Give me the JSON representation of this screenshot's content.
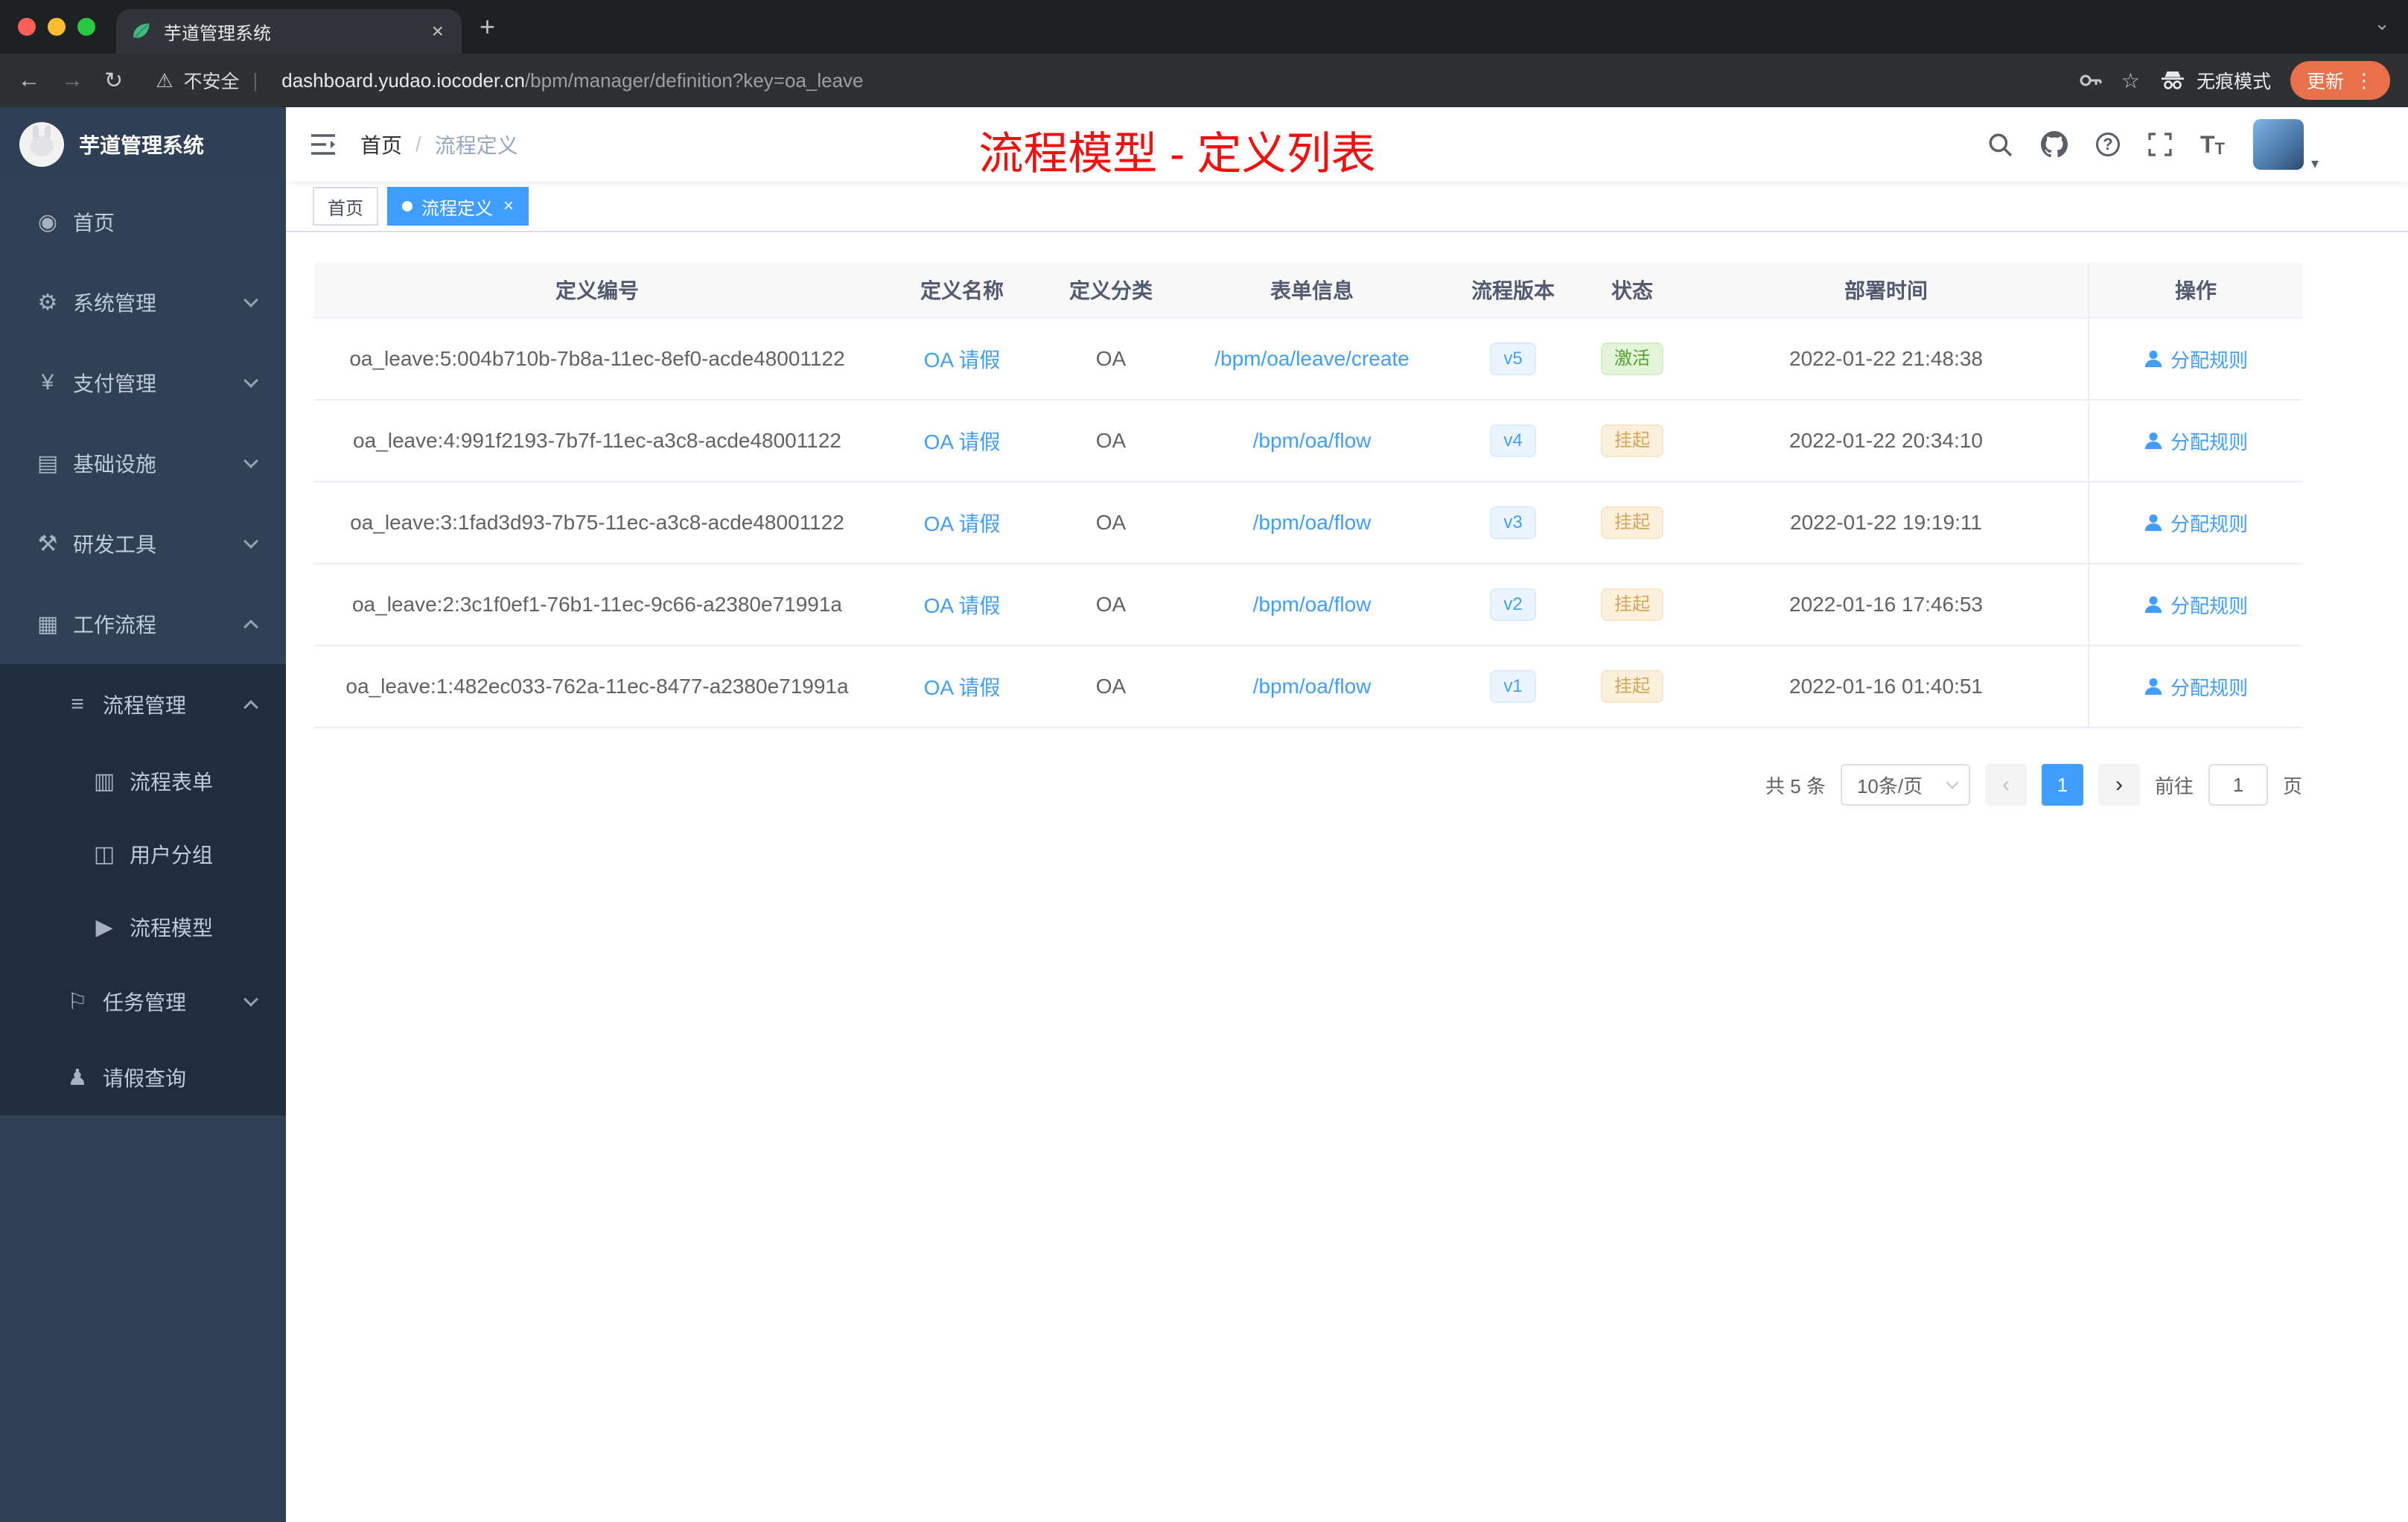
{
  "colors": {
    "accent": "#409eff",
    "sidebar": "#304156",
    "sidebar_sub": "#1f2d3d",
    "annotation_red": "#f40f0f"
  },
  "browser": {
    "tab": {
      "title": "芋道管理系统",
      "close": "×",
      "new_tab": "+"
    },
    "toolbar": {
      "security_label": "不安全",
      "url_host": "dashboard.yudao.iocoder.cn",
      "url_path": "/bpm/manager/definition?key=oa_leave",
      "incognito_label": "无痕模式",
      "update_label": "更新"
    }
  },
  "icons": {
    "back": "←",
    "forward": "→",
    "reload": "↻",
    "warning": "⚠",
    "divider": "|",
    "star": "☆",
    "kebab": "⋮",
    "tab_overflow": "⌄",
    "help": "?",
    "caret": "▾",
    "t_large": "T",
    "t_small": "T"
  },
  "sidebar": {
    "logo_title": "芋道管理系统",
    "menu": [
      {
        "label": "首页",
        "icon": "◉"
      },
      {
        "label": "系统管理",
        "icon": "⚙"
      },
      {
        "label": "支付管理",
        "icon": "¥"
      },
      {
        "label": "基础设施",
        "icon": "▤"
      },
      {
        "label": "研发工具",
        "icon": "⚒"
      },
      {
        "label": "工作流程",
        "icon": "▦"
      },
      {
        "label": "流程管理",
        "icon": "≡"
      },
      {
        "label": "流程表单",
        "icon": "▥"
      },
      {
        "label": "用户分组",
        "icon": "◫"
      },
      {
        "label": "流程模型",
        "icon": "▶"
      },
      {
        "label": "任务管理",
        "icon": "⚐"
      },
      {
        "label": "请假查询",
        "icon": "♟"
      }
    ]
  },
  "header": {
    "breadcrumb_home": "首页",
    "breadcrumb_sep": "/",
    "breadcrumb_current": "流程定义",
    "annotation": "流程模型 - 定义列表"
  },
  "tags": {
    "home": "首页",
    "current": "流程定义",
    "close": "×"
  },
  "table": {
    "columns": [
      "定义编号",
      "定义名称",
      "定义分类",
      "表单信息",
      "流程版本",
      "状态",
      "部署时间",
      "操作"
    ],
    "action_label": "分配规则",
    "rows": [
      {
        "id": "oa_leave:5:004b710b-7b8a-11ec-8ef0-acde48001122",
        "name": "OA 请假",
        "category": "OA",
        "form": "/bpm/oa/leave/create",
        "version": "v5",
        "status": "激活",
        "time": "2022-01-22 21:48:38"
      },
      {
        "id": "oa_leave:4:991f2193-7b7f-11ec-a3c8-acde48001122",
        "name": "OA 请假",
        "category": "OA",
        "form": "/bpm/oa/flow",
        "version": "v4",
        "status": "挂起",
        "time": "2022-01-22 20:34:10"
      },
      {
        "id": "oa_leave:3:1fad3d93-7b75-11ec-a3c8-acde48001122",
        "name": "OA 请假",
        "category": "OA",
        "form": "/bpm/oa/flow",
        "version": "v3",
        "status": "挂起",
        "time": "2022-01-22 19:19:11"
      },
      {
        "id": "oa_leave:2:3c1f0ef1-76b1-11ec-9c66-a2380e71991a",
        "name": "OA 请假",
        "category": "OA",
        "form": "/bpm/oa/flow",
        "version": "v2",
        "status": "挂起",
        "time": "2022-01-16 17:46:53"
      },
      {
        "id": "oa_leave:1:482ec033-762a-11ec-8477-a2380e71991a",
        "name": "OA 请假",
        "category": "OA",
        "form": "/bpm/oa/flow",
        "version": "v1",
        "status": "挂起",
        "time": "2022-01-16 01:40:51"
      }
    ]
  },
  "pagination": {
    "total": "共 5 条",
    "page_size": "10条/页",
    "prev": "‹",
    "page": "1",
    "next": "›",
    "goto": "前往",
    "goto_value": "1",
    "page_unit": "页"
  }
}
